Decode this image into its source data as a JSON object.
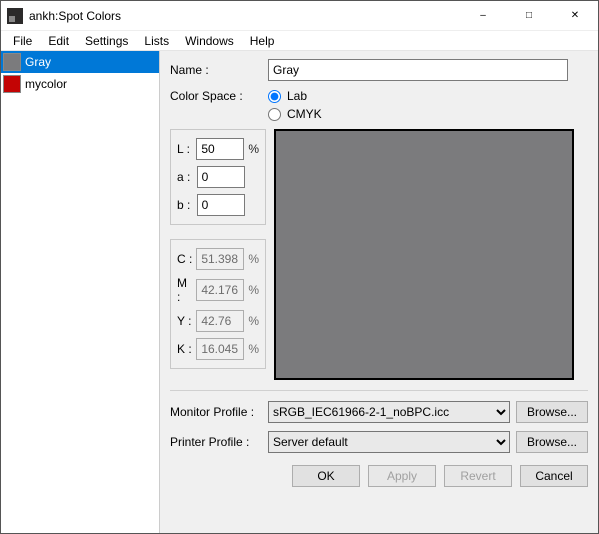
{
  "window": {
    "title": "ankh:Spot Colors"
  },
  "menus": [
    "File",
    "Edit",
    "Settings",
    "Lists",
    "Windows",
    "Help"
  ],
  "sidebar": {
    "items": [
      {
        "label": "Gray",
        "color": "#7b7b7d",
        "selected": true
      },
      {
        "label": "mycolor",
        "color": "#c30404",
        "selected": false
      }
    ]
  },
  "form": {
    "name_label": "Name :",
    "name_value": "Gray",
    "colorspace_label": "Color Space :",
    "radio_lab": "Lab",
    "radio_cmyk": "CMYK",
    "lab": {
      "L": "50",
      "a": "0",
      "b": "0"
    },
    "cmyk": {
      "C": "51.398",
      "M": "42.176",
      "Y": "42.76",
      "K": "16.045"
    },
    "preview_color": "#7b7b7d"
  },
  "profiles": {
    "monitor_label": "Monitor Profile :",
    "monitor_value": "sRGB_IEC61966-2-1_noBPC.icc",
    "printer_label": "Printer Profile :",
    "printer_value": "Server default",
    "browse": "Browse..."
  },
  "buttons": {
    "ok": "OK",
    "apply": "Apply",
    "revert": "Revert",
    "cancel": "Cancel"
  },
  "labels": {
    "L": "L :",
    "a": "a :",
    "b": "b :",
    "C": "C :",
    "M": "M :",
    "Y": "Y :",
    "K": "K :",
    "pct": "%"
  }
}
